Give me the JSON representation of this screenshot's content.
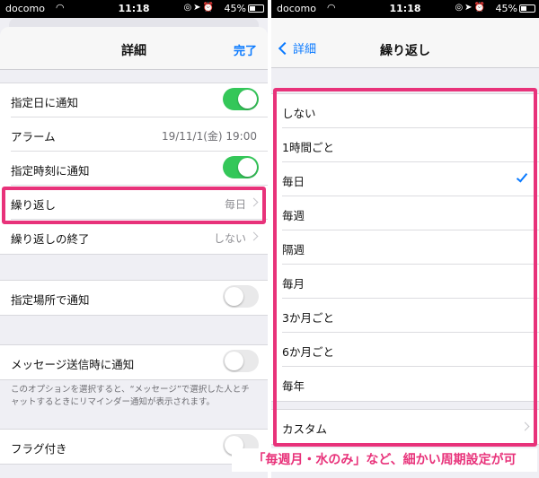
{
  "status": {
    "carrier": "docomo",
    "time": "11:18",
    "battery": "45%"
  },
  "left": {
    "title": "詳細",
    "done": "完了",
    "rows1": [
      {
        "label": "指定日に通知",
        "toggle": true
      },
      {
        "label": "アラーム",
        "value": "19/11/1(金) 19:00"
      },
      {
        "label": "指定時刻に通知",
        "toggle": true
      },
      {
        "label": "繰り返し",
        "value": "毎日"
      },
      {
        "label": "繰り返しの終了",
        "value": "しない"
      }
    ],
    "location_label": "指定場所で通知",
    "message_label": "メッセージ送信時に通知",
    "message_note": "このオプションを選択すると、“メッセージ”で選択した人とチャットするときにリマインダー通知が表示されます。",
    "flag_label": "フラグ付き"
  },
  "right": {
    "back": "詳細",
    "title": "繰り返し",
    "options": [
      "しない",
      "1時間ごと",
      "毎日",
      "毎週",
      "隔週",
      "毎月",
      "3か月ごと",
      "6か月ごと",
      "毎年"
    ],
    "selected": "毎日",
    "custom": "カスタム"
  },
  "caption": "「毎週月・水のみ」など、細かい周期設定が可",
  "colors": {
    "accent": "#0a7aff",
    "toggle_on": "#34c759",
    "highlight": "#e8327a"
  }
}
